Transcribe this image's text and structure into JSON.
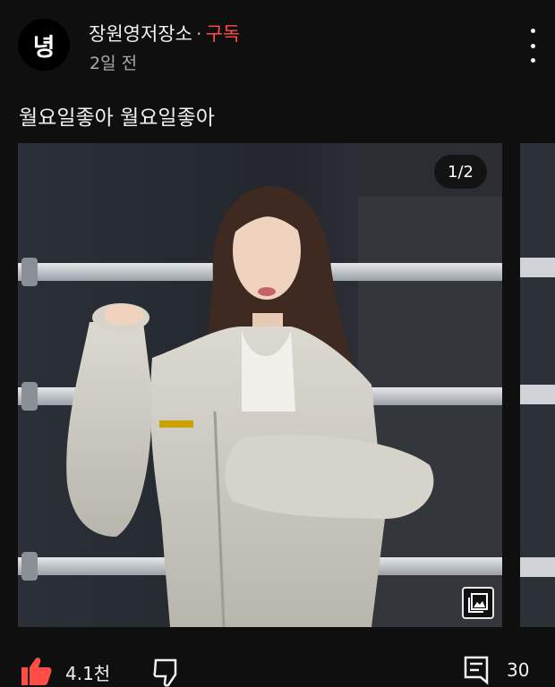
{
  "channel": {
    "avatar_text": "녕",
    "name": "장원영저장소",
    "separator": "·",
    "subscribe_label": "구독",
    "time_ago": "2일 전"
  },
  "post": {
    "text": "월요일좋아 월요일좋아"
  },
  "carousel": {
    "counter": "1/2"
  },
  "actions": {
    "like_count": "4.1천",
    "comment_count": "30"
  },
  "icons": [
    "more-vert-icon",
    "gallery-icon",
    "like-icon",
    "dislike-icon",
    "comment-icon"
  ],
  "colors": {
    "background": "#0f0f0f",
    "subscribe": "#ff4e45",
    "like": "#ff4e45"
  }
}
